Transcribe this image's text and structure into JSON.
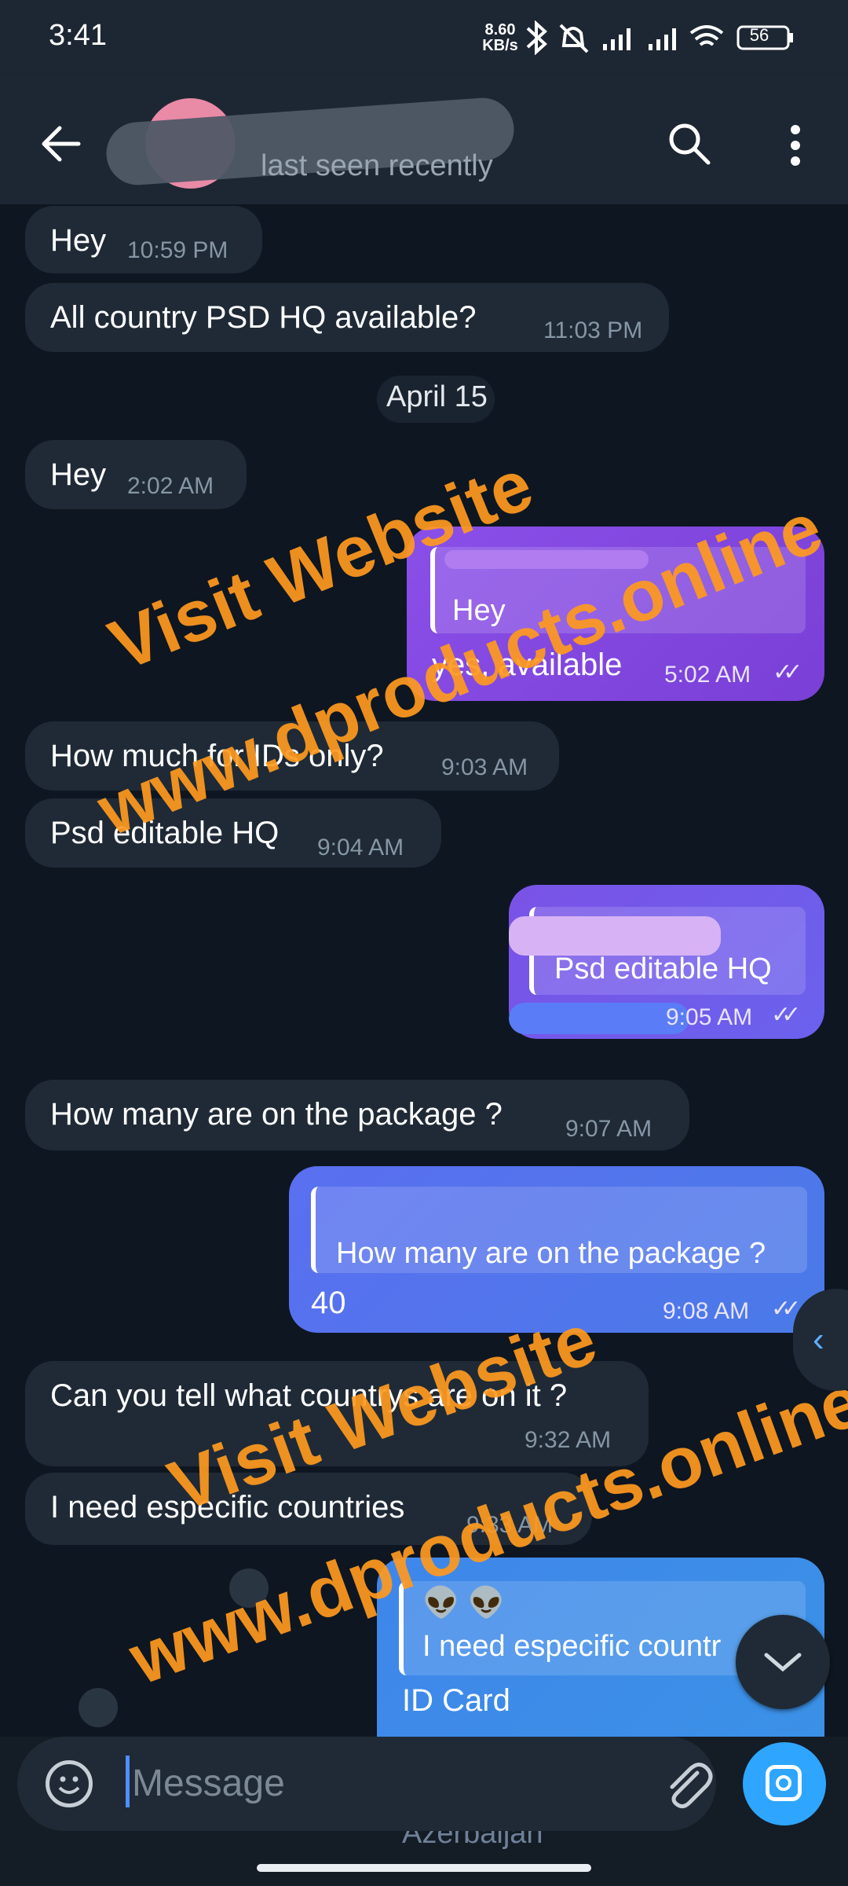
{
  "status_bar": {
    "time": "3:41",
    "net_speed": "8.60 KB/s",
    "battery": "56"
  },
  "header": {
    "back_icon": "arrow-left-icon",
    "last_seen": "last seen recently",
    "search_icon": "search-icon",
    "menu_icon": "more-vertical-icon"
  },
  "messages": {
    "m1": {
      "text": "Hey",
      "time": "10:59 PM"
    },
    "m2": {
      "text": "All country PSD HQ available?",
      "time": "11:03 PM"
    },
    "date": "April 15",
    "m3": {
      "text": "Hey",
      "time": "2:02 AM"
    },
    "m4": {
      "quote": "Hey",
      "text": "yes, available",
      "time": "5:02 AM"
    },
    "m5": {
      "text": "How much for IDs only?",
      "time": "9:03 AM"
    },
    "m6": {
      "text": "Psd editable HQ",
      "time": "9:04 AM"
    },
    "m7": {
      "quote": "Psd editable HQ",
      "time": "9:05 AM"
    },
    "m8": {
      "text": "How many are on the package ?",
      "time": "9:07 AM"
    },
    "m9": {
      "quote": "How many are on the package ?",
      "text": "40",
      "time": "9:08 AM"
    },
    "m10": {
      "text": "Can you tell what countrys are on it ?",
      "time": "9:32 AM"
    },
    "m11": {
      "text": "I need especific countries",
      "time": "9:33 AM"
    },
    "m12": {
      "quote_emoji": "👽 👽",
      "quote": "I need especific countr",
      "text": "ID Card",
      "peek": "Azerbaijan"
    }
  },
  "watermark": {
    "line1": "Visit Website",
    "line2": "www.dproducts.online"
  },
  "input": {
    "placeholder": "Message"
  },
  "colors": {
    "background": "#0e1621",
    "incoming": "#1f2a36",
    "accent": "#2ea6ff",
    "watermark": "#ff9a1f"
  }
}
